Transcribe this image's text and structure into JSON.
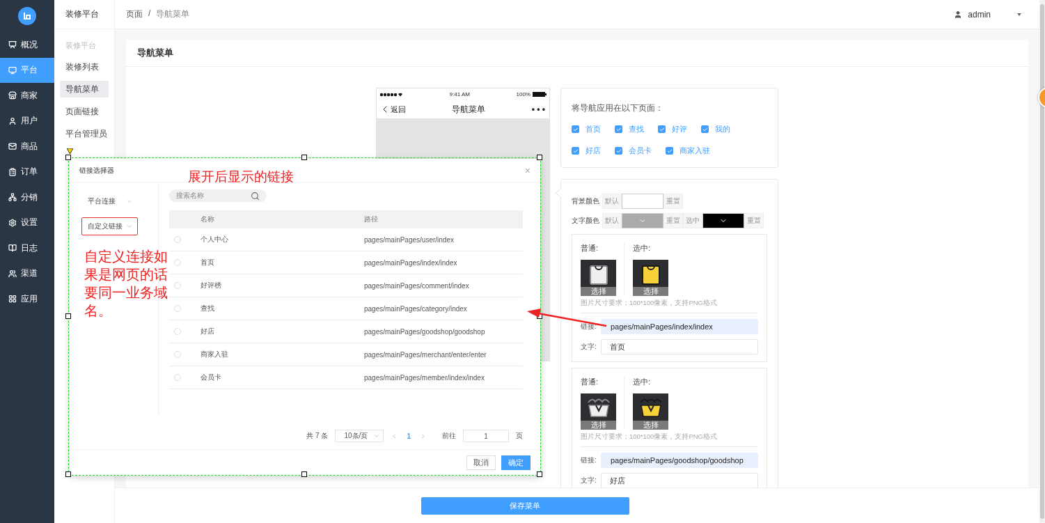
{
  "sidebar": {
    "items": [
      {
        "label": "概况",
        "selected": false
      },
      {
        "label": "平台",
        "selected": true
      },
      {
        "label": "商家",
        "selected": false
      },
      {
        "label": "用户",
        "selected": false
      },
      {
        "label": "商品",
        "selected": false
      },
      {
        "label": "订单",
        "selected": false
      },
      {
        "label": "分销",
        "selected": false
      },
      {
        "label": "设置",
        "selected": false
      },
      {
        "label": "日志",
        "selected": false
      },
      {
        "label": "渠道",
        "selected": false
      },
      {
        "label": "应用",
        "selected": false
      }
    ]
  },
  "subnav": {
    "title": "装修平台",
    "section": "装修平台",
    "items": [
      {
        "label": "装修列表",
        "selected": false
      },
      {
        "label": "导航菜单",
        "selected": true
      },
      {
        "label": "页面链接",
        "selected": false
      },
      {
        "label": "平台管理员",
        "selected": false
      }
    ]
  },
  "topbar": {
    "breadcrumb": [
      "页面",
      "导航菜单"
    ],
    "separator": "/",
    "user": "admin"
  },
  "page": {
    "title": "导航菜单",
    "save": "保存菜单"
  },
  "phone": {
    "time": "9:41 AM",
    "battery": "100%",
    "back": "返回",
    "title": "导航菜单",
    "more": "• • •"
  },
  "apply_pages": {
    "label": "将导航应用在以下页面：",
    "options": [
      {
        "label": "首页",
        "checked": true
      },
      {
        "label": "查找",
        "checked": true
      },
      {
        "label": "好评",
        "checked": true
      },
      {
        "label": "我的",
        "checked": true
      },
      {
        "label": "好店",
        "checked": true
      },
      {
        "label": "会员卡",
        "checked": true
      },
      {
        "label": "商家入驻",
        "checked": true
      }
    ]
  },
  "color_rows": [
    {
      "label": "背景颜色",
      "parts": [
        {
          "kind": "text",
          "text": "默认"
        },
        {
          "kind": "swatch",
          "color": "#ffffff"
        },
        {
          "kind": "button",
          "text": "重置"
        }
      ]
    },
    {
      "label": "文字颜色",
      "parts": [
        {
          "kind": "text",
          "text": "默认"
        },
        {
          "kind": "swatch",
          "color": "#aaaaaa",
          "dropdown": true
        },
        {
          "kind": "button",
          "text": "重置"
        },
        {
          "kind": "text",
          "text": "选中"
        },
        {
          "kind": "swatch",
          "color": "#000000",
          "dropdown": true
        },
        {
          "kind": "button",
          "text": "重置"
        }
      ]
    }
  ],
  "nav_items": [
    {
      "kind": "bag",
      "normal_label": "普通:",
      "selected_label": "选中:",
      "choose_normal": "选择",
      "choose_selected": "选择",
      "hint": "图片尺寸要求：100*100像素，支持PNG格式",
      "link_label": "链接:",
      "link": "pages/mainPages/index/index",
      "text_label": "文字:",
      "text": "首页"
    },
    {
      "kind": "basket",
      "normal_label": "普通:",
      "selected_label": "选中:",
      "choose_normal": "选择",
      "choose_selected": "选择",
      "hint": "图片尺寸要求：100*100像素，支持PNG格式",
      "link_label": "链接:",
      "link": "pages/mainPages/goodshop/goodshop",
      "text_label": "文字:",
      "text": "好店"
    }
  ],
  "dialog": {
    "title": "链接选择器",
    "close": "×",
    "categories": [
      {
        "label": "平台连接",
        "highlighted": false
      },
      {
        "label": "自定义链接",
        "highlighted": true
      }
    ],
    "search": {
      "placeholder": "搜索名称"
    },
    "columns": [
      "名称",
      "路径"
    ],
    "rows": [
      {
        "name": "个人中心",
        "path": "pages/mainPages/user/index",
        "selected": false
      },
      {
        "name": "首页",
        "path": "pages/mainPages/index/index",
        "selected": false
      },
      {
        "name": "好评榜",
        "path": "pages/mainPages/comment/index",
        "selected": false
      },
      {
        "name": "查找",
        "path": "pages/mainPages/category/index",
        "selected": false
      },
      {
        "name": "好店",
        "path": "pages/mainPages/goodshop/goodshop",
        "selected": false
      },
      {
        "name": "商家入驻",
        "path": "pages/mainPages/merchant/enter/enter",
        "selected": false
      },
      {
        "name": "会员卡",
        "path": "pages/mainPages/member/index/index",
        "selected": false
      }
    ],
    "pagination": {
      "total": "共 7 条",
      "page_size": "10条/页",
      "current": "1",
      "goto_label": "前往",
      "goto_value": "1",
      "page_unit": "页"
    },
    "cancel": "取消",
    "confirm": "确定"
  },
  "annotations": {
    "title_note": "展开后显示的链接",
    "side_note": "自定义连接如果是网页的话要同一业务域名。"
  }
}
